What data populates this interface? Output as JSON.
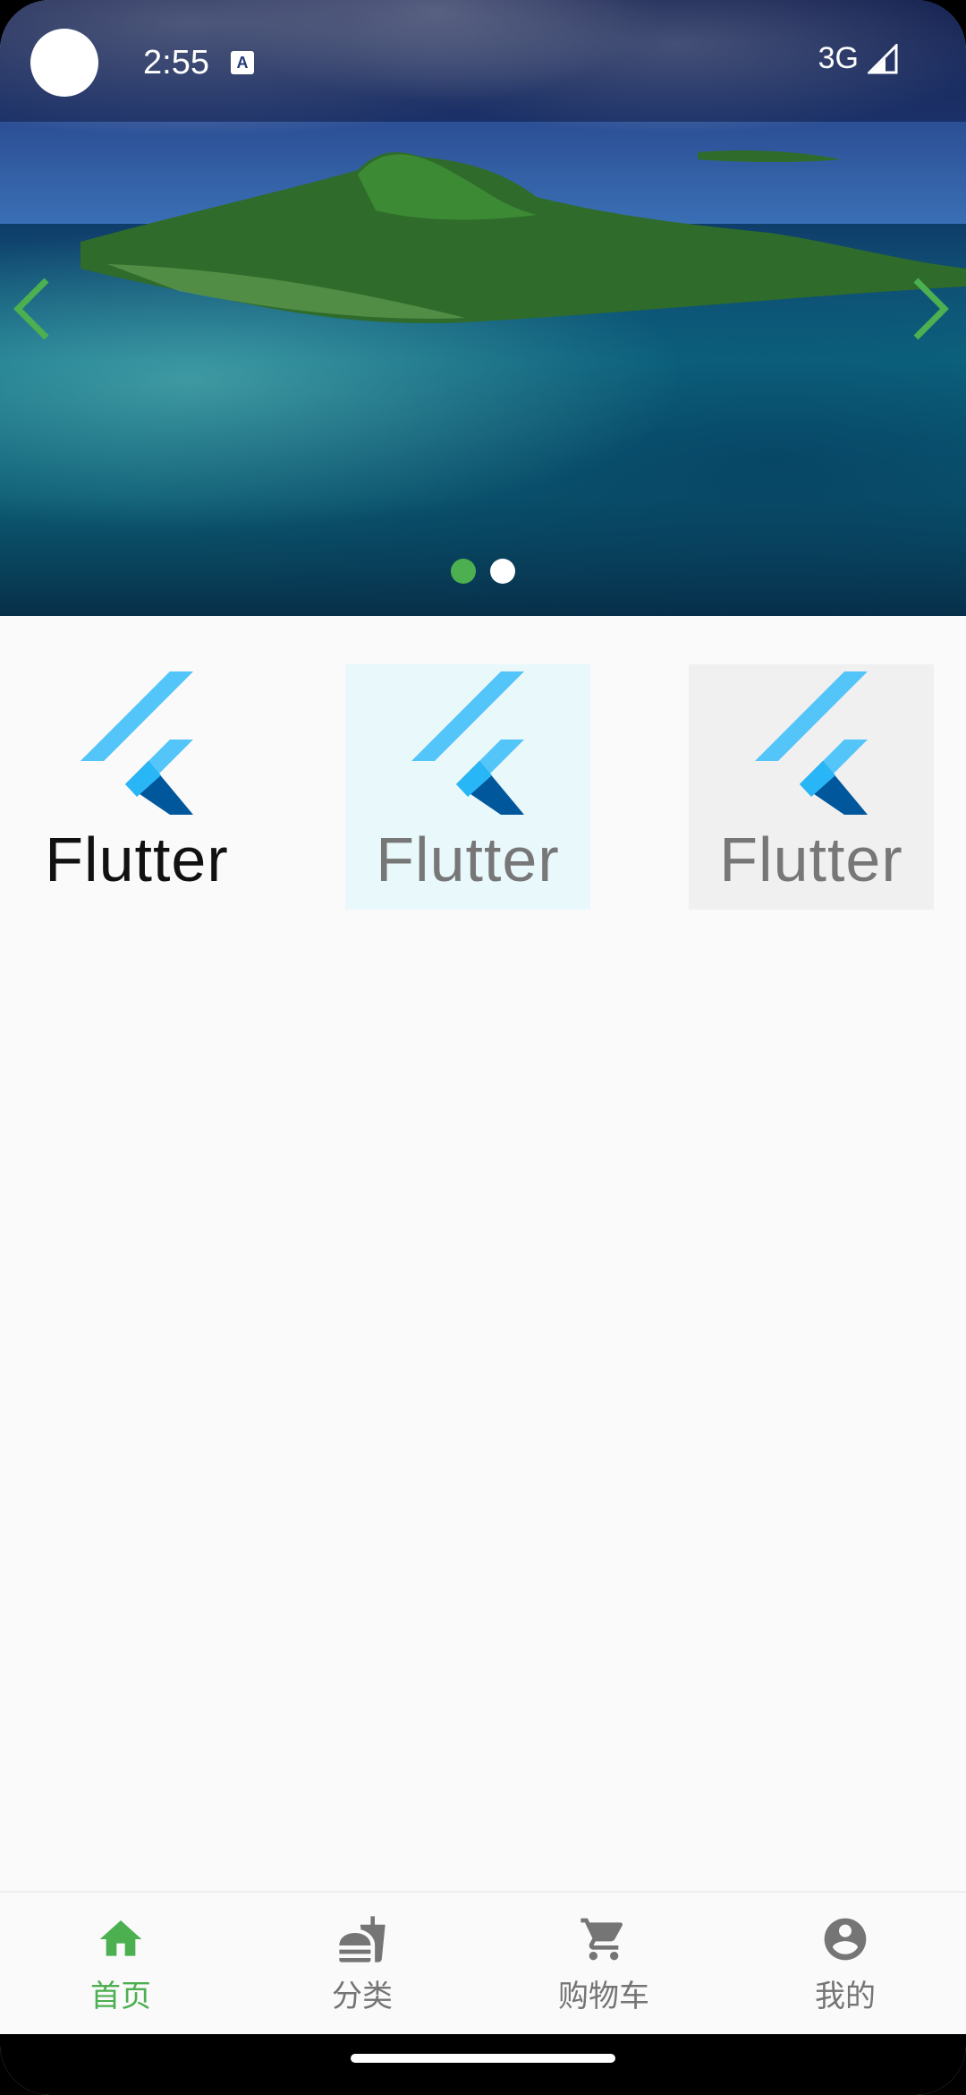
{
  "status_bar": {
    "time": "2:55",
    "notification_badge": "A",
    "network": "3G"
  },
  "banner": {
    "arrow_color": "#4caf50",
    "active_dot_color": "#4caf50",
    "inactive_dot_color": "#ffffff",
    "slide_count": 2,
    "current_slide": 1
  },
  "tiles": [
    {
      "label": "Flutter"
    },
    {
      "label": "Flutter"
    },
    {
      "label": "Flutter"
    }
  ],
  "bottom_nav": {
    "active_color": "#4caf50",
    "inactive_color": "#757575",
    "items": [
      {
        "label": "首页",
        "icon": "home-icon",
        "active": true
      },
      {
        "label": "分类",
        "icon": "fastfood-icon",
        "active": false
      },
      {
        "label": "购物车",
        "icon": "cart-icon",
        "active": false
      },
      {
        "label": "我的",
        "icon": "account-icon",
        "active": false
      }
    ]
  }
}
